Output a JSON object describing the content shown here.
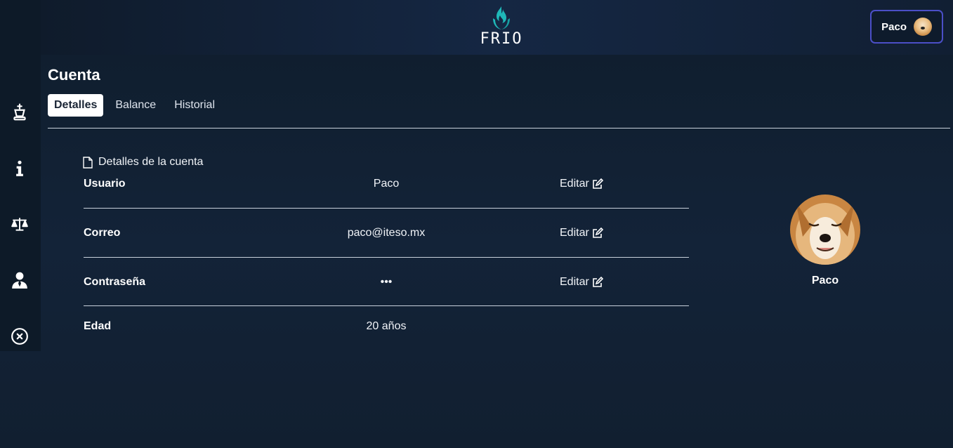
{
  "header": {
    "logo_text": "FRIO",
    "user_button": {
      "name": "Paco"
    }
  },
  "sidebar": {
    "items": [
      {
        "icon": "chess-king-icon"
      },
      {
        "icon": "info-icon"
      },
      {
        "icon": "scale-balance-icon"
      },
      {
        "icon": "user-tie-icon"
      },
      {
        "icon": "close-circle-icon"
      }
    ]
  },
  "page": {
    "title": "Cuenta",
    "tabs": [
      {
        "label": "Detalles",
        "active": true
      },
      {
        "label": "Balance",
        "active": false
      },
      {
        "label": "Historial",
        "active": false
      }
    ]
  },
  "details": {
    "heading": "Detalles de la cuenta",
    "rows": [
      {
        "label": "Usuario",
        "value": "Paco",
        "edit": "Editar"
      },
      {
        "label": "Correo",
        "value": "paco@iteso.mx",
        "edit": "Editar"
      },
      {
        "label": "Contraseña",
        "value": "•••",
        "edit": "Editar"
      },
      {
        "label": "Edad",
        "value": "20 años"
      }
    ]
  },
  "profile": {
    "name": "Paco"
  },
  "colors": {
    "accent_teal": "#1fb8b8",
    "user_button_border": "#4b4fc7",
    "background": "#132338"
  }
}
